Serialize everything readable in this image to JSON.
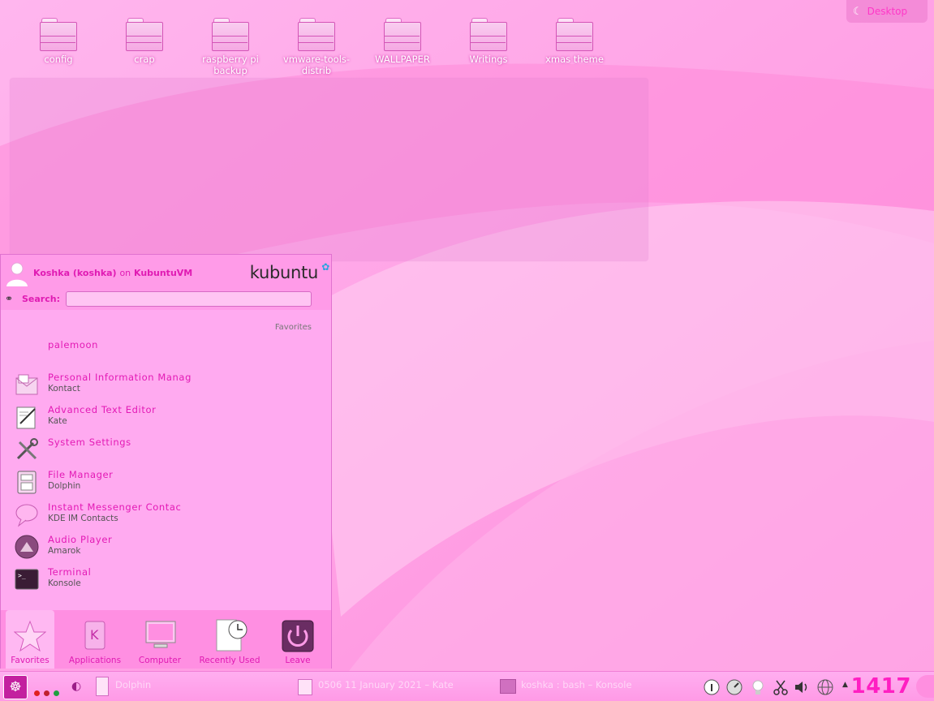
{
  "desktop": {
    "icons": [
      {
        "label": "config"
      },
      {
        "label": "crap"
      },
      {
        "label": "raspberry pi backup"
      },
      {
        "label": "vmware-tools-distrib"
      },
      {
        "label": "WALLPAPER"
      },
      {
        "label": "Writings"
      },
      {
        "label": "xmas theme"
      }
    ],
    "toolbox_label": "Desktop"
  },
  "kickoff": {
    "user_name": "Koshka (koshka)",
    "user_on": "on",
    "host": "KubuntuVM",
    "brand": "kubuntu",
    "search_label": "Search:",
    "search_value": "",
    "favorites_title": "Favorites",
    "items": [
      {
        "name": "palemoon",
        "sub": "",
        "icon": "none"
      },
      {
        "name": "Personal Information Manag",
        "sub": "Kontact",
        "icon": "kontact-icon"
      },
      {
        "name": "Advanced Text Editor",
        "sub": "Kate",
        "icon": "kate-icon"
      },
      {
        "name": "System Settings",
        "sub": "",
        "icon": "settings-icon"
      },
      {
        "name": "File Manager",
        "sub": "Dolphin",
        "icon": "file-manager-icon"
      },
      {
        "name": "Instant Messenger Contac",
        "sub": "KDE IM Contacts",
        "icon": "chat-icon"
      },
      {
        "name": "Audio Player",
        "sub": "Amarok",
        "icon": "amarok-icon"
      },
      {
        "name": "Terminal",
        "sub": "Konsole",
        "icon": "terminal-icon"
      }
    ],
    "tabs": [
      {
        "label": "Favorites",
        "active": true
      },
      {
        "label": "Applications",
        "active": false
      },
      {
        "label": "Computer",
        "active": false
      },
      {
        "label": "Recently Used",
        "active": false
      },
      {
        "label": "Leave",
        "active": false
      }
    ]
  },
  "panel": {
    "tasks": [
      {
        "label": "Dolphin"
      },
      {
        "label": "0506 11 January 2021 – Kate"
      },
      {
        "label": "koshka : bash – Konsole"
      }
    ],
    "clock": "1417"
  },
  "colors": {
    "accent": "#e01bb3",
    "wallpaper": "#ffa6ea",
    "clock": "#ff1fc2"
  }
}
